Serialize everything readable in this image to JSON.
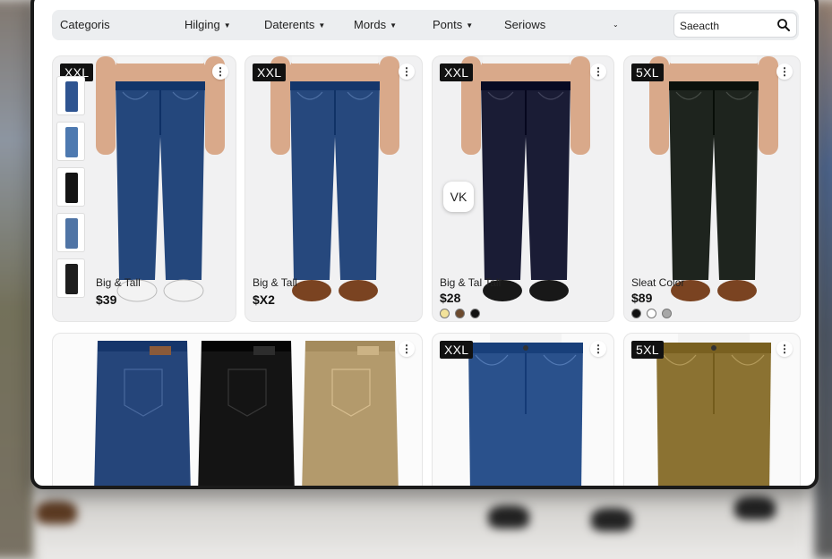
{
  "nav": {
    "items": [
      {
        "label": "Categoris",
        "chevron": false
      },
      {
        "label": "Hilging",
        "chevron": true
      },
      {
        "label": "Daterents",
        "chevron": true
      },
      {
        "label": "Mords",
        "chevron": true
      },
      {
        "label": "Ponts",
        "chevron": true
      },
      {
        "label": "Seriows",
        "chevron": false
      }
    ],
    "dropdown_icon": "chevron-down-icon",
    "search": {
      "placeholder": "Saeacth",
      "icon": "search-icon"
    }
  },
  "floating_badge": "VK",
  "products": [
    {
      "badge": "XXL",
      "title": "Big & Tall",
      "price": "$39",
      "pant_color": "#24477c",
      "shoe": "sneaker",
      "thumbnails": [
        "#2e5491",
        "#4d79b0",
        "#141414",
        "#4f74a5",
        "#1e1e1e"
      ]
    },
    {
      "badge": "XXL",
      "title": "Big & Tall",
      "price": "$X2",
      "pant_color": "#26487d",
      "shoe": "brown"
    },
    {
      "badge": "XXL",
      "title": "Big & Tal Tall",
      "price": "$28",
      "pant_color": "#1a1c35",
      "shoe": "black",
      "swatches": [
        "#f2e29a",
        "#6c4a2e",
        "#111111"
      ]
    },
    {
      "badge": "5XL",
      "title": "Sleat Color",
      "price": "$89",
      "pant_color": "#1e241e",
      "shoe": "brown",
      "swatches": [
        "#111111",
        "#ffffff",
        "#a7a7a7"
      ]
    },
    {
      "badge": "",
      "folded": [
        "#25457a",
        "#141414",
        "#b39a6c"
      ]
    },
    {
      "badge": "XXL",
      "pant_color": "#2a518c"
    },
    {
      "badge": "5XL",
      "pant_color": "#8b7232"
    }
  ],
  "colors": {
    "badge_bg": "#111111",
    "navbar_bg": "#eceef0"
  }
}
